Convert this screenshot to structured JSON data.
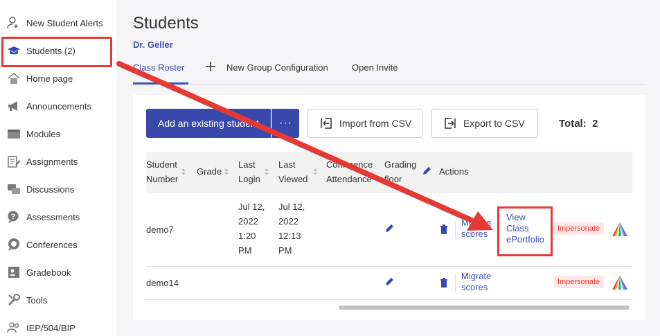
{
  "sidebar": {
    "items": [
      {
        "label": "New Student Alerts",
        "icon": "person-alert-icon"
      },
      {
        "label": "Students (2)",
        "icon": "graduation-cap-icon"
      },
      {
        "label": "Home page",
        "icon": "home-icon"
      },
      {
        "label": "Announcements",
        "icon": "megaphone-icon"
      },
      {
        "label": "Modules",
        "icon": "folder-icon"
      },
      {
        "label": "Assignments",
        "icon": "clipboard-edit-icon"
      },
      {
        "label": "Discussions",
        "icon": "chat-bubbles-icon"
      },
      {
        "label": "Assessments",
        "icon": "question-bubble-icon"
      },
      {
        "label": "Conferences",
        "icon": "chat-bubble-icon"
      },
      {
        "label": "Gradebook",
        "icon": "gradebook-icon"
      },
      {
        "label": "Tools",
        "icon": "wrench-icon"
      },
      {
        "label": "IEP/504/BIP",
        "icon": "people-icon"
      }
    ]
  },
  "main": {
    "title": "Students",
    "teacher": "Dr. Geller",
    "tabs": [
      {
        "label": "Class Roster"
      },
      {
        "label": "New Group Configuration"
      },
      {
        "label": "Open Invite"
      }
    ],
    "toolbar": {
      "add_label": "Add an existing student",
      "more_label": "···",
      "import_label": "Import from CSV",
      "export_label": "Export to CSV",
      "total_label": "Total:",
      "total_value": "2"
    },
    "table": {
      "headers": {
        "student_number_1": "Student",
        "student_number_2": "Number",
        "grade": "Grade",
        "last_login_1": "Last",
        "last_login_2": "Login",
        "last_viewed_1": "Last",
        "last_viewed_2": "Viewed",
        "conference_1": "Conference",
        "conference_2": "Attendance",
        "grading_floor_1": "Grading",
        "grading_floor_2": "floor",
        "actions": "Actions"
      },
      "rows": [
        {
          "student_number": "demo7",
          "last_login": [
            "Jul 12,",
            "2022",
            "1:20",
            "PM"
          ],
          "last_viewed": [
            "Jul 12,",
            "2022",
            "12:13",
            "PM"
          ],
          "migrate": [
            "Migrate",
            "scores"
          ],
          "view_portfolio": [
            "View",
            "Class",
            "ePortfolio"
          ],
          "impersonate": "Impersonate"
        },
        {
          "student_number": "demo14",
          "migrate": [
            "Migrate",
            "scores"
          ],
          "impersonate": "Impersonate"
        }
      ]
    }
  },
  "colors": {
    "accent": "#3949ab",
    "annotation_red": "#e53935"
  }
}
